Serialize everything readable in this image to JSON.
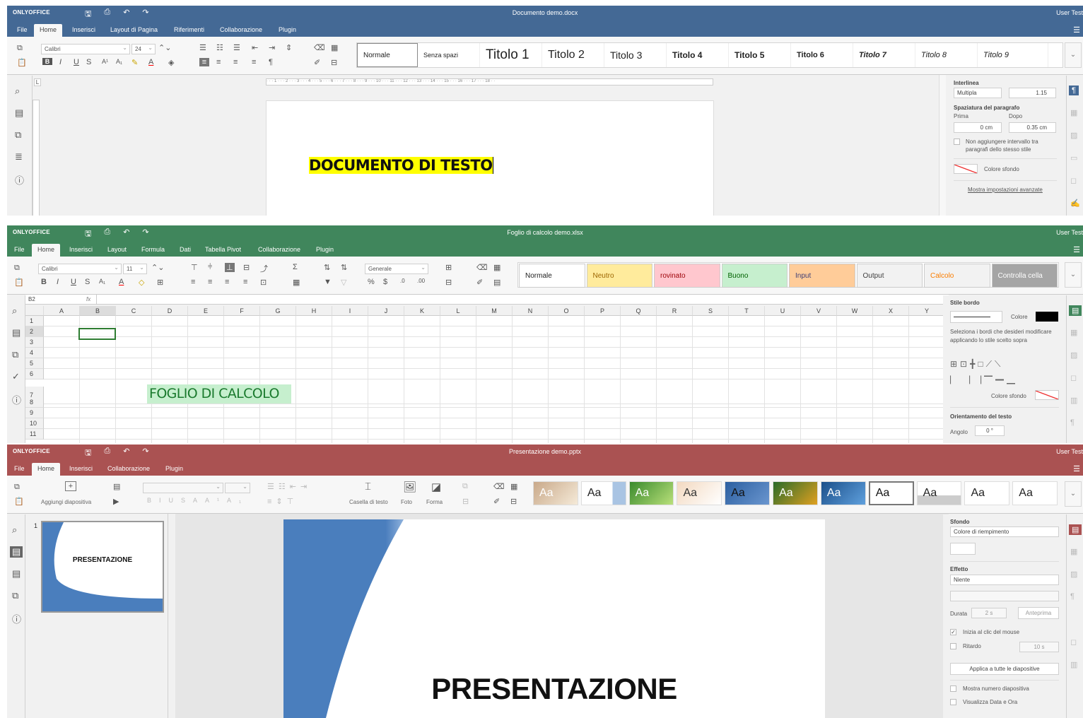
{
  "common": {
    "logo": "ONLYOFFICE",
    "user": "User Test",
    "file_tab": "File",
    "home_tab": "Home"
  },
  "colors": {
    "doc_header": "#446995",
    "sheet_header": "#40865c",
    "pres_header": "#aa5252",
    "highlight_yellow": "#ffff00",
    "sheet_cell_fill": "#c6efce",
    "sheet_cell_text": "#1a7a2d"
  },
  "doc": {
    "title": "Documento demo.docx",
    "tabs": [
      "Inserisci",
      "Layout di Pagina",
      "Riferimenti",
      "Collaborazione",
      "Plugin"
    ],
    "font": "Calibri",
    "size": "24",
    "styles": [
      "Normale",
      "Senza spazi",
      "Titolo 1",
      "Titolo 2",
      "Titolo 3",
      "Titolo 4",
      "Titolo 5",
      "Titolo 6",
      "Titolo 7",
      "Titolo 8",
      "Titolo 9"
    ],
    "body_text": "DOCUMENTO DI TESTO",
    "panel": {
      "line_spacing_label": "Interlinea",
      "line_spacing_value": "Multipla",
      "line_spacing_num": "1.15",
      "para_spacing_label": "Spaziatura del paragrafo",
      "before_label": "Prima",
      "after_label": "Dopo",
      "before_value": "0 cm",
      "after_value": "0.35 cm",
      "no_interval": "Non aggiungere intervallo tra paragrafi dello stesso stile",
      "bg_color": "Colore sfondo",
      "advanced": "Mostra impostazioni avanzate"
    }
  },
  "sheet": {
    "title": "Foglio di calcolo demo.xlsx",
    "tabs": [
      "Inserisci",
      "Layout",
      "Formula",
      "Dati",
      "Tabella Pivot",
      "Collaborazione",
      "Plugin"
    ],
    "font": "Calibri",
    "size": "11",
    "number_format": "Generale",
    "cell_ref": "B2",
    "fx": "fx",
    "styles": [
      {
        "label": "Normale",
        "bg": "#ffffff",
        "fg": "#222222"
      },
      {
        "label": "Neutro",
        "bg": "#ffeb9c",
        "fg": "#9c6500"
      },
      {
        "label": "rovinato",
        "bg": "#ffc7ce",
        "fg": "#9c0006"
      },
      {
        "label": "Buono",
        "bg": "#c6efce",
        "fg": "#006100"
      },
      {
        "label": "Input",
        "bg": "#ffcc99",
        "fg": "#3f3f76"
      },
      {
        "label": "Output",
        "bg": "#f2f2f2",
        "fg": "#3f3f3f"
      },
      {
        "label": "Calcolo",
        "bg": "#f2f2f2",
        "fg": "#fa7d00"
      },
      {
        "label": "Controlla cella",
        "bg": "#a5a5a5",
        "fg": "#ffffff"
      }
    ],
    "columns": [
      "A",
      "B",
      "C",
      "D",
      "E",
      "F",
      "G",
      "H",
      "I",
      "J",
      "K",
      "L",
      "M",
      "N",
      "O",
      "P",
      "Q",
      "R",
      "S",
      "T",
      "U",
      "V",
      "W",
      "X",
      "Y"
    ],
    "rows": [
      "1",
      "2",
      "3",
      "4",
      "5",
      "6",
      "7",
      "8",
      "9",
      "10",
      "11"
    ],
    "cell_text": "FOGLIO DI CALCOLO",
    "panel": {
      "border_style": "Stile bordo",
      "color": "Colore",
      "select_borders": "Seleziona i bordi che desideri modificare applicando lo stile scelto sopra",
      "bg_color": "Colore sfondo",
      "orientation": "Orientamento del testo",
      "angle": "Angolo",
      "angle_value": "0 °"
    }
  },
  "pres": {
    "title": "Presentazione demo.pptx",
    "tabs": [
      "Inserisci",
      "Collaborazione",
      "Plugin"
    ],
    "add_slide": "Aggiungi diapositiva",
    "text_box": "Casella di testo",
    "photo": "Foto",
    "shape": "Forma",
    "slide_number": "1",
    "thumb_text": "PRESENTAZIONE",
    "slide_text": "PRESENTAZIONE",
    "themes": [
      "Aa",
      "Aa",
      "Aa",
      "Aa",
      "Aa",
      "Aa",
      "Aa",
      "Aa",
      "Aa",
      "Aa",
      "Aa"
    ],
    "panel": {
      "background": "Sfondo",
      "fill": "Colore di riempimento",
      "effect": "Effetto",
      "effect_value": "Niente",
      "duration": "Durata",
      "duration_value": "2 s",
      "preview": "Anteprima",
      "on_click": "Inizia al clic del mouse",
      "delay": "Ritardo",
      "delay_value": "10 s",
      "apply_all": "Applica a tutte le diapositive",
      "show_number": "Mostra numero diapositiva",
      "show_date": "Visualizza Data e Ora"
    }
  }
}
